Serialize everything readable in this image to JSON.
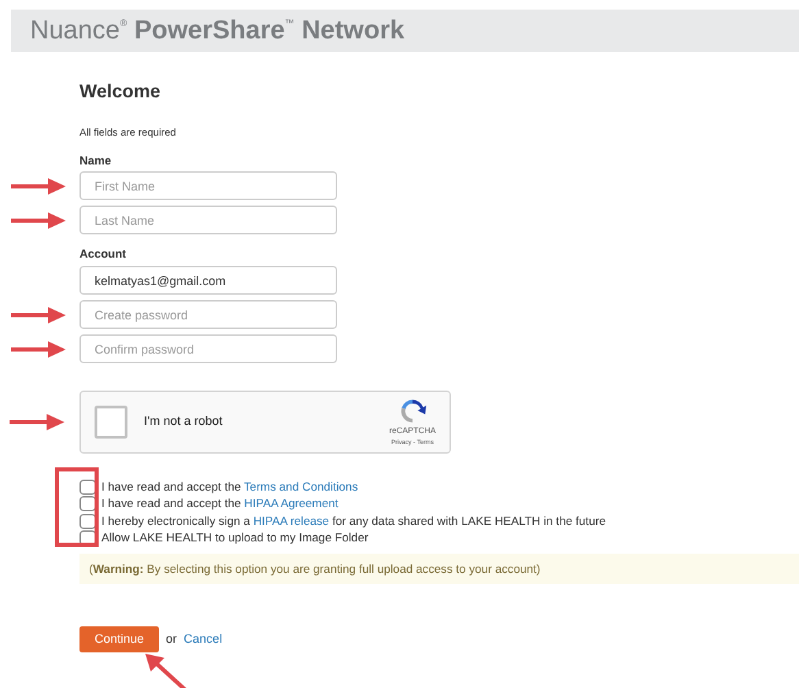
{
  "header": {
    "title": "Nuance$^{®}$ **PowerShare**$^{™}$ **Network**"
  },
  "heading": "Welcome",
  "note": "All fields are required",
  "sections": [
    {
      "label": "Name",
      "fields": [
        {
          "placeholder": "First Name",
          "marked": true
        },
        {
          "placeholder": "Last Name",
          "marked": true
        }
      ]
    },
    {
      "label": "Account",
      "fields": [
        {
          "value": "kelmatyas1@gmail.com"
        },
        {
          "placeholder": "Create password",
          "marked": true
        },
        {
          "placeholder": "Confirm password",
          "marked": true
        }
      ]
    }
  ],
  "captcha": {
    "label": "I'm not a robot",
    "checked": false,
    "brand": "reCAPTCHA",
    "links": "Privacy - Terms",
    "marked": true
  },
  "agreements_marked": true,
  "agreements": [
    {
      "before": "I have read and accept the ",
      "link": "Terms and Conditions",
      "checked": false
    },
    {
      "before": "I have read and accept the ",
      "link": "HIPAA Agreement",
      "checked": false
    },
    {
      "before": "I hereby electronically sign a ",
      "link": "HIPAA release",
      "after": " for any data shared with LAKE HEALTH in the future",
      "checked": false
    },
    {
      "before": "Allow LAKE HEALTH to upload to my Image Folder",
      "checked": false
    }
  ],
  "warning": "(**Warning:** By selecting this option you are granting full upload access to your account)",
  "actions": {
    "continue": "Continue",
    "or": "or",
    "cancel": "Cancel",
    "marked": true
  }
}
